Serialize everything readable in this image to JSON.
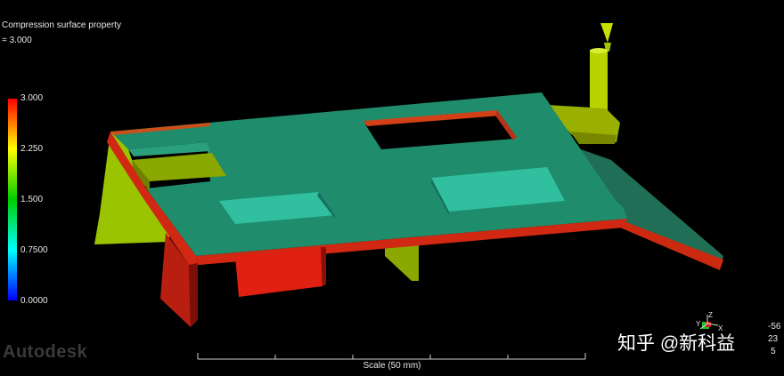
{
  "result": {
    "title": "Compression surface property",
    "value": " = 3.000"
  },
  "legend": {
    "colors": [
      "#ff0000",
      "#ffff00",
      "#00cc00",
      "#00ffff",
      "#0000ff"
    ],
    "labels": [
      "3.000",
      "2.250",
      "1.500",
      "0.7500",
      "0.0000"
    ]
  },
  "scale": {
    "label": "Scale (50 mm)"
  },
  "watermark": {
    "brand": "Autodesk",
    "zhihu": "知乎 @新科益"
  },
  "orientation": {
    "axes": [
      "Y",
      "Z",
      "X"
    ],
    "readout": [
      "-56",
      "23",
      "5"
    ]
  }
}
